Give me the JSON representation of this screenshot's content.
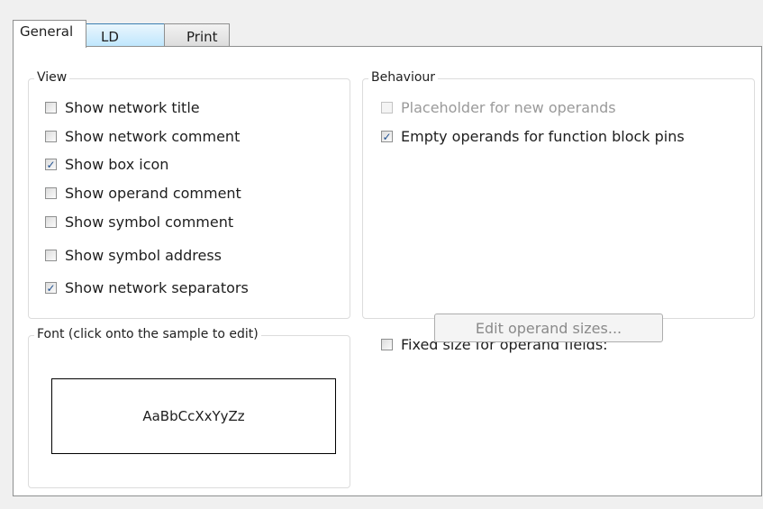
{
  "tabs": [
    {
      "label": "General"
    },
    {
      "label": "LD"
    },
    {
      "label": "Print"
    }
  ],
  "view": {
    "title": "View",
    "items": [
      {
        "label": "Show network title",
        "checked": false
      },
      {
        "label": "Show network comment",
        "checked": false
      },
      {
        "label": "Show box icon",
        "checked": true
      },
      {
        "label": "Show operand comment",
        "checked": false
      },
      {
        "label": "Show symbol comment",
        "checked": false
      },
      {
        "label": "Show symbol address",
        "checked": false
      },
      {
        "label": "Show network separators",
        "checked": true
      }
    ]
  },
  "behaviour": {
    "title": "Behaviour",
    "items": [
      {
        "label": "Placeholder for new operands",
        "checked": false,
        "enabled": false
      },
      {
        "label": "Empty operands for function block pins",
        "checked": true,
        "enabled": true
      }
    ]
  },
  "font": {
    "title": "Font (click onto the sample to edit)",
    "sample": "AaBbCcXxYyZz"
  },
  "fixed_size": {
    "label": "Fixed size for operand fields:",
    "checked": false,
    "button_label": "Edit operand sizes...",
    "button_enabled": false
  }
}
